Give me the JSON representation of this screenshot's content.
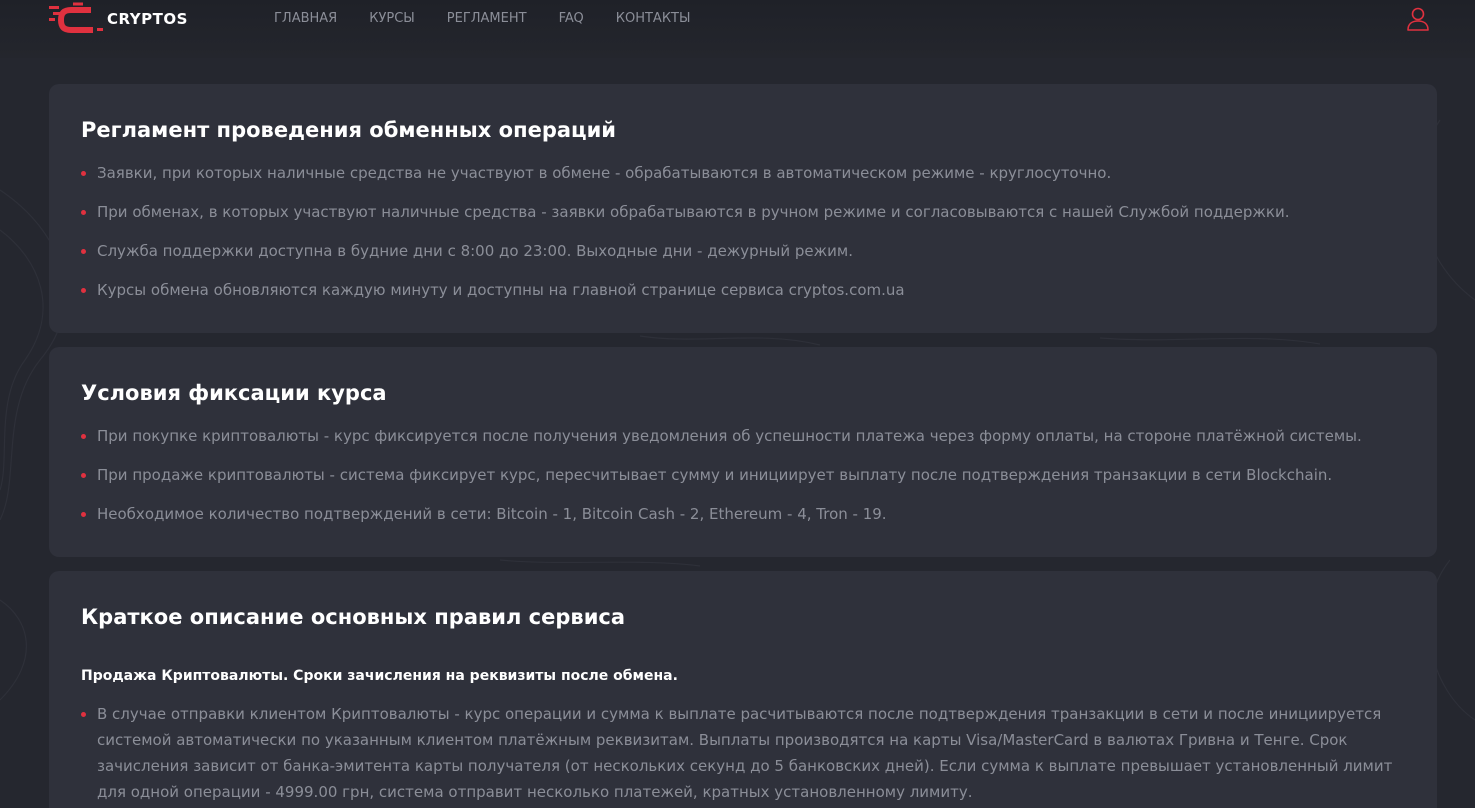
{
  "header": {
    "logo_text": "CRYPTOS",
    "nav": [
      "ГЛАВНАЯ",
      "КУРСЫ",
      "РЕГЛАМЕНТ",
      "FAQ",
      "КОНТАКТЫ"
    ],
    "user_icon": "user-icon"
  },
  "colors": {
    "accent": "#e0313f",
    "background": "#25272f",
    "card": "#2f313b",
    "text_muted": "#8b8e98"
  },
  "sections": [
    {
      "title": "Регламент проведения обменных операций",
      "items": [
        "Заявки, при которых наличные средства не участвуют в обмене - обрабатываются в автоматическом режиме - круглосуточно.",
        "При обменах, в которых участвуют наличные средства - заявки обрабатываются в ручном режиме и согласовываются с нашей Службой поддержки.",
        "Служба поддержки доступна в будние дни с 8:00 до 23:00. Выходные дни - дежурный режим.",
        "Курсы обмена обновляются каждую минуту и доступны на главной странице сервиса cryptos.com.ua"
      ]
    },
    {
      "title": "Условия фиксации курса",
      "items": [
        "При покупке криптовалюты - курс фиксируется после получения уведомления об успешности платежа через форму оплаты, на стороне платёжной системы.",
        "При продаже криптовалюты - система фиксирует курс, пересчитывает сумму и инициирует выплату после подтверждения транзакции в сети Blockchain.",
        "Необходимое количество подтверждений в сети: Bitcoin - 1, Bitcoin Cash - 2, Ethereum - 4, Tron - 19."
      ]
    },
    {
      "title": "Краткое описание основных правил сервиса",
      "subtitle": "Продажа Криптовалюты. Сроки зачисления на реквизиты после обмена.",
      "items": [
        "В случае отправки клиентом Криптовалюты - курс операции и сумма к выплате расчитываются после подтверждения транзакции в сети и после инициируется системой автоматически по указанным клиентом платёжным реквизитам. Выплаты производятся на карты Visa/MasterCard в валютах Гривна и Тенге. Срок зачисления зависит от банка-эмитента карты получателя (от нескольких секунд до 5 банковских дней). Если сумма к выплате превышает установленный лимит для одной операции - 4999.00 грн, система отправит несколько платежей, кратных установленному лимиту."
      ]
    }
  ]
}
